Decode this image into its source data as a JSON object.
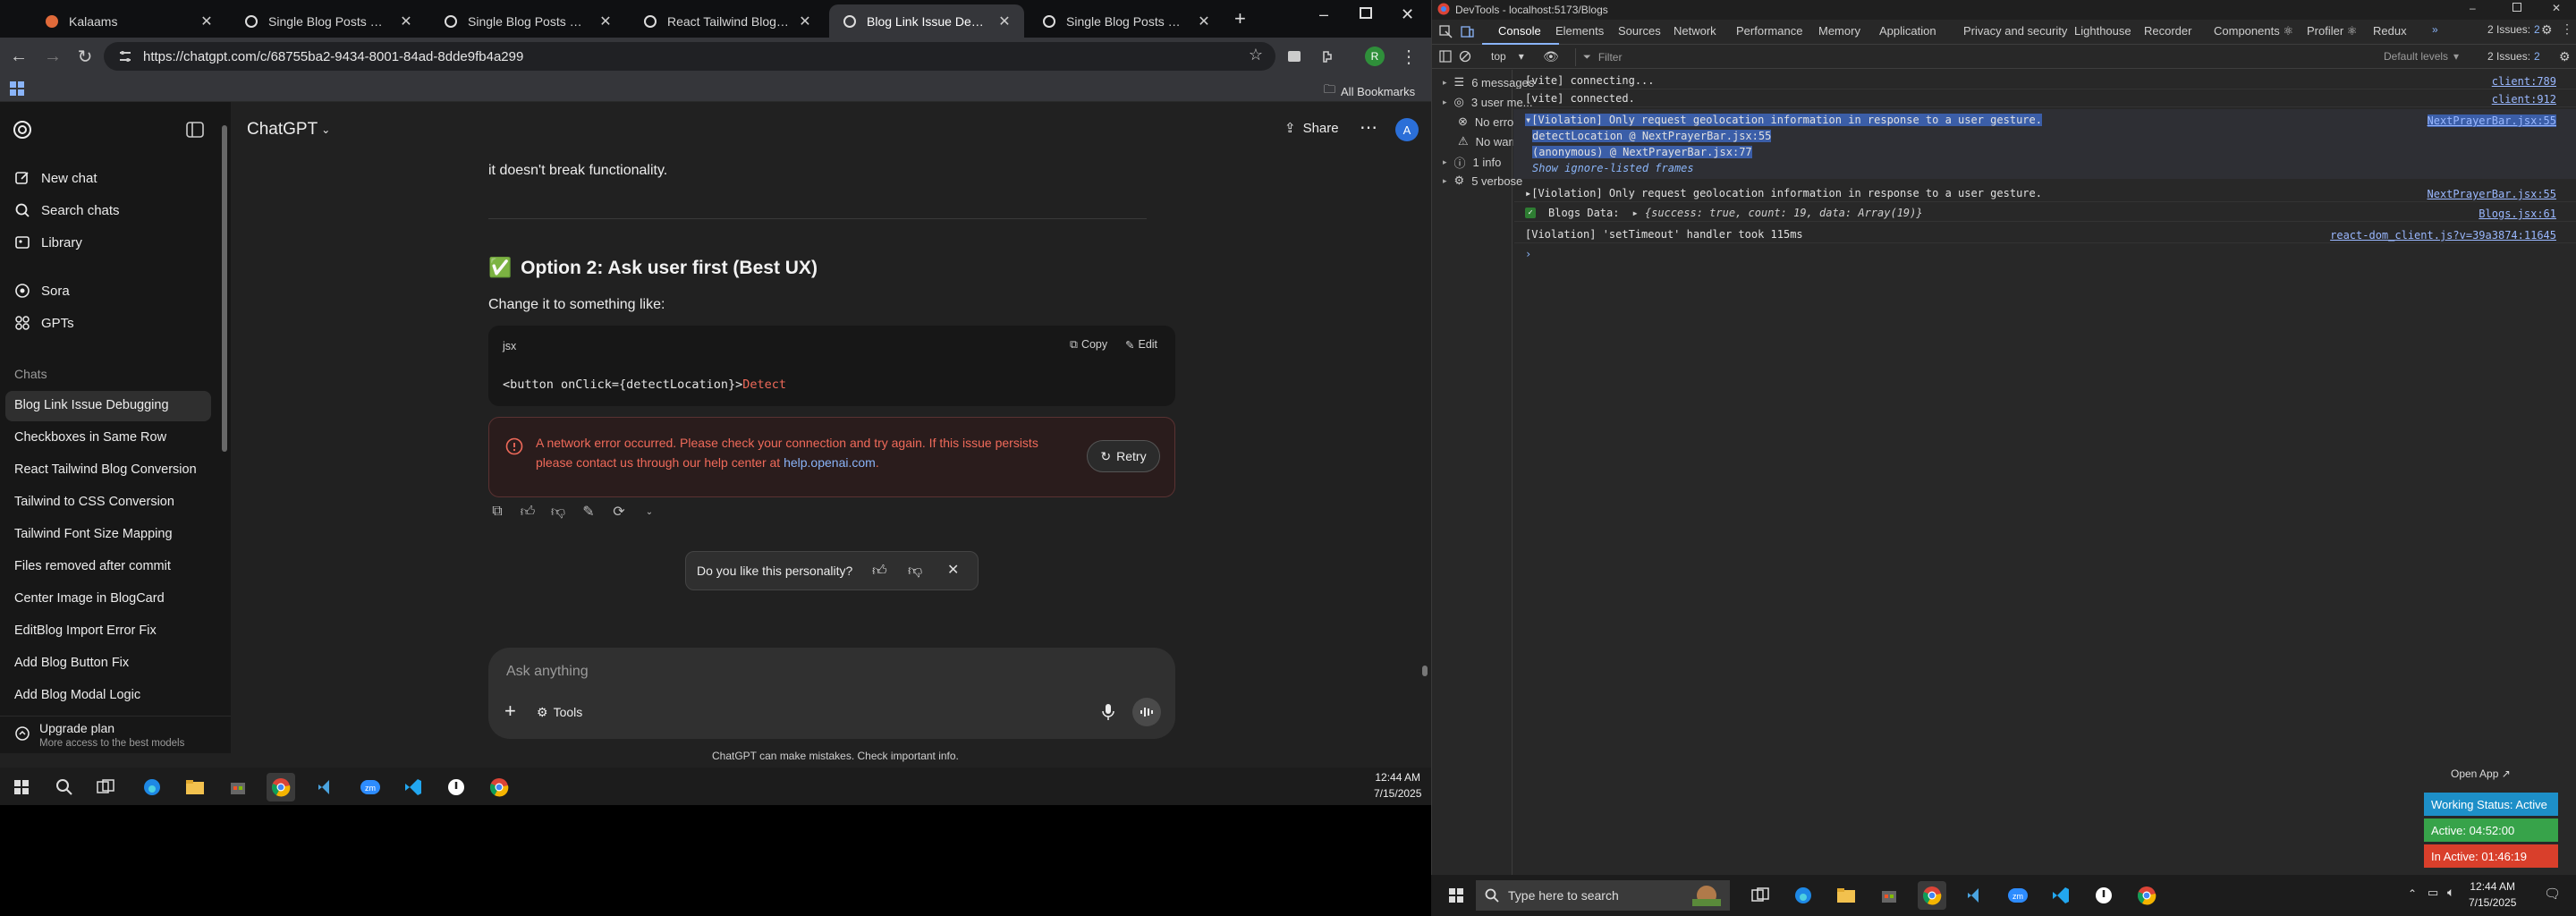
{
  "browser": {
    "tabs": [
      {
        "title": "Kalaams",
        "fav": "#e06a3a"
      },
      {
        "title": "Single Blog Posts Page Desig",
        "fav": "#ececec"
      },
      {
        "title": "Single Blog Posts Page Desig",
        "fav": "#ececec"
      },
      {
        "title": "React Tailwind Blog Convers",
        "fav": "#ececec"
      },
      {
        "title": "Blog Link Issue Debugging",
        "fav": "#ececec"
      },
      {
        "title": "Single Blog Posts Page Desig",
        "fav": "#ececec"
      }
    ],
    "url": "https://chatgpt.com/c/68755ba2-9434-8001-84ad-8dde9fb4a299",
    "bookmarks_label": "All Bookmarks",
    "profile_letter": "R"
  },
  "sidebar": {
    "new_chat": "New chat",
    "search": "Search chats",
    "library": "Library",
    "sora": "Sora",
    "gpts": "GPTs",
    "chats_heading": "Chats",
    "chats": [
      "Blog Link Issue Debugging",
      "Checkboxes in Same Row",
      "React Tailwind Blog Conversion",
      "Tailwind to CSS Conversion",
      "Tailwind Font Size Mapping",
      "Files removed after commit",
      "Center Image in BlogCard",
      "EditBlog Import Error Fix",
      "Add Blog Button Fix",
      "Add Blog Modal Logic"
    ],
    "upgrade_title": "Upgrade plan",
    "upgrade_sub": "More access to the best models"
  },
  "header": {
    "model": "ChatGPT",
    "share": "Share",
    "avatar": "A"
  },
  "conversation": {
    "prev_text": "it doesn't break functionality.",
    "option_heading": "Option 2: Ask user first (Best UX)",
    "option_emoji": "✅",
    "change_text": "Change it to something like:",
    "code_lang": "jsx",
    "copy": "Copy",
    "edit": "Edit",
    "code_plain": "<button onClick={detectLocation}>",
    "code_highlight": "Detect",
    "error_line1": "A network error occurred. Please check your connection and try again. If this issue persists",
    "error_line2_prefix": "please contact us through our help center at ",
    "error_link": "help.openai.com",
    "error_suffix": ".",
    "retry": "Retry",
    "personality_q": "Do you like this personality?"
  },
  "composer": {
    "placeholder": "Ask anything",
    "tools": "Tools",
    "disclaimer": "ChatGPT can make mistakes. Check important info."
  },
  "taskbar_small": {
    "time": "12:44 AM",
    "date": "7/15/2025"
  },
  "devtools": {
    "title": "DevTools - localhost:5173/Blogs",
    "tabs": [
      "Console",
      "Elements",
      "Sources",
      "Network",
      "Performance",
      "Memory",
      "Application",
      "Privacy and security",
      "Lighthouse",
      "Recorder",
      "Components ⚛",
      "Profiler ⚛",
      "Redux"
    ],
    "issues": "2 Issues:",
    "issues_count": "2",
    "context": "top",
    "filter_placeholder": "Filter",
    "levels": "Default levels",
    "filters": [
      {
        "label": "6 messages",
        "icon": "list-icon"
      },
      {
        "label": "3 user me...",
        "icon": "user-icon"
      },
      {
        "label": "No errors",
        "icon": "error-icon"
      },
      {
        "label": "No warnin...",
        "icon": "warning-icon"
      },
      {
        "label": "1 info",
        "icon": "info-icon"
      },
      {
        "label": "5 verbose",
        "icon": "verbose-icon"
      }
    ],
    "messages": [
      {
        "text": "[vite] connecting...",
        "link": "client:789"
      },
      {
        "text": "[vite] connected.",
        "link": "client:912"
      },
      {
        "text": "▾[Violation] Only request geolocation information in response to a user gesture.",
        "link": "NextPrayerBar.jsx:55"
      },
      {
        "text": "detectLocation @ NextPrayerBar.jsx:55",
        "link": ""
      },
      {
        "text": "(anonymous) @ NextPrayerBar.jsx:77",
        "link": ""
      },
      {
        "text": "Show ignore-listed frames",
        "link": ""
      },
      {
        "text": "▸[Violation] Only request geolocation information in response to a user gesture.",
        "link": "NextPrayerBar.jsx:55"
      },
      {
        "text": "Blogs Data:",
        "obj": "▸ {success: true, count: 19, data: Array(19)}",
        "link": "Blogs.jsx:61"
      },
      {
        "text": "[Violation] 'setTimeout' handler took 115ms",
        "link": "react-dom_client.js?v=39a3874:11645"
      }
    ],
    "prompt": "›"
  },
  "widget": {
    "open_app": "Open App ↗",
    "working": "Working Status: Active",
    "active": "Active: 04:52:00",
    "inactive": "In Active: 01:46:19"
  },
  "taskbar_main": {
    "search_placeholder": "Type here to search",
    "time": "12:44 AM",
    "date": "7/15/2025"
  }
}
